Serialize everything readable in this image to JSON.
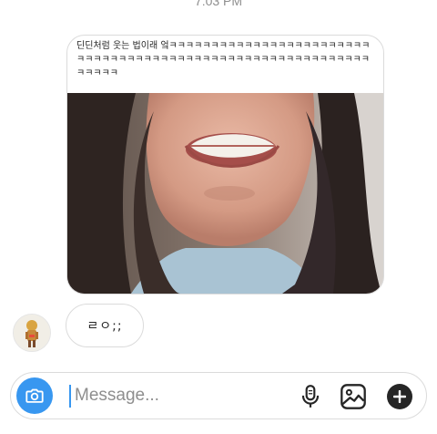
{
  "thread": {
    "timestamp": "7:03 PM"
  },
  "shared_post": {
    "caption": "딘딘처럼 웃는 법이래 엌ㅋㅋㅋㅋㅋㅋㅋㅋㅋㅋㅋㅋㅋㅋㅋㅋㅋㅋㅋㅋㅋㅋㅋㅋㅋㅋㅋㅋㅋㅋㅋㅋㅋㅋㅋㅋㅋㅋㅋㅋㅋㅋㅋㅋㅋㅋㅋㅋㅋㅋㅋㅋㅋㅋㅋㅋㅋㅋㅋㅋㅋㅋㅋㅋ",
    "image": "smiling-face-photo"
  },
  "reply": {
    "text": "ㄹㅇ;;",
    "avatar": "cartoon-character-avatar"
  },
  "composer": {
    "placeholder": "Message...",
    "value": "",
    "icons": [
      "camera-icon",
      "microphone-icon",
      "gallery-icon",
      "plus-icon"
    ]
  },
  "colors": {
    "accent": "#3897f0",
    "border": "#dbdbdb",
    "text": "#262626",
    "muted": "#8e8e8e"
  }
}
